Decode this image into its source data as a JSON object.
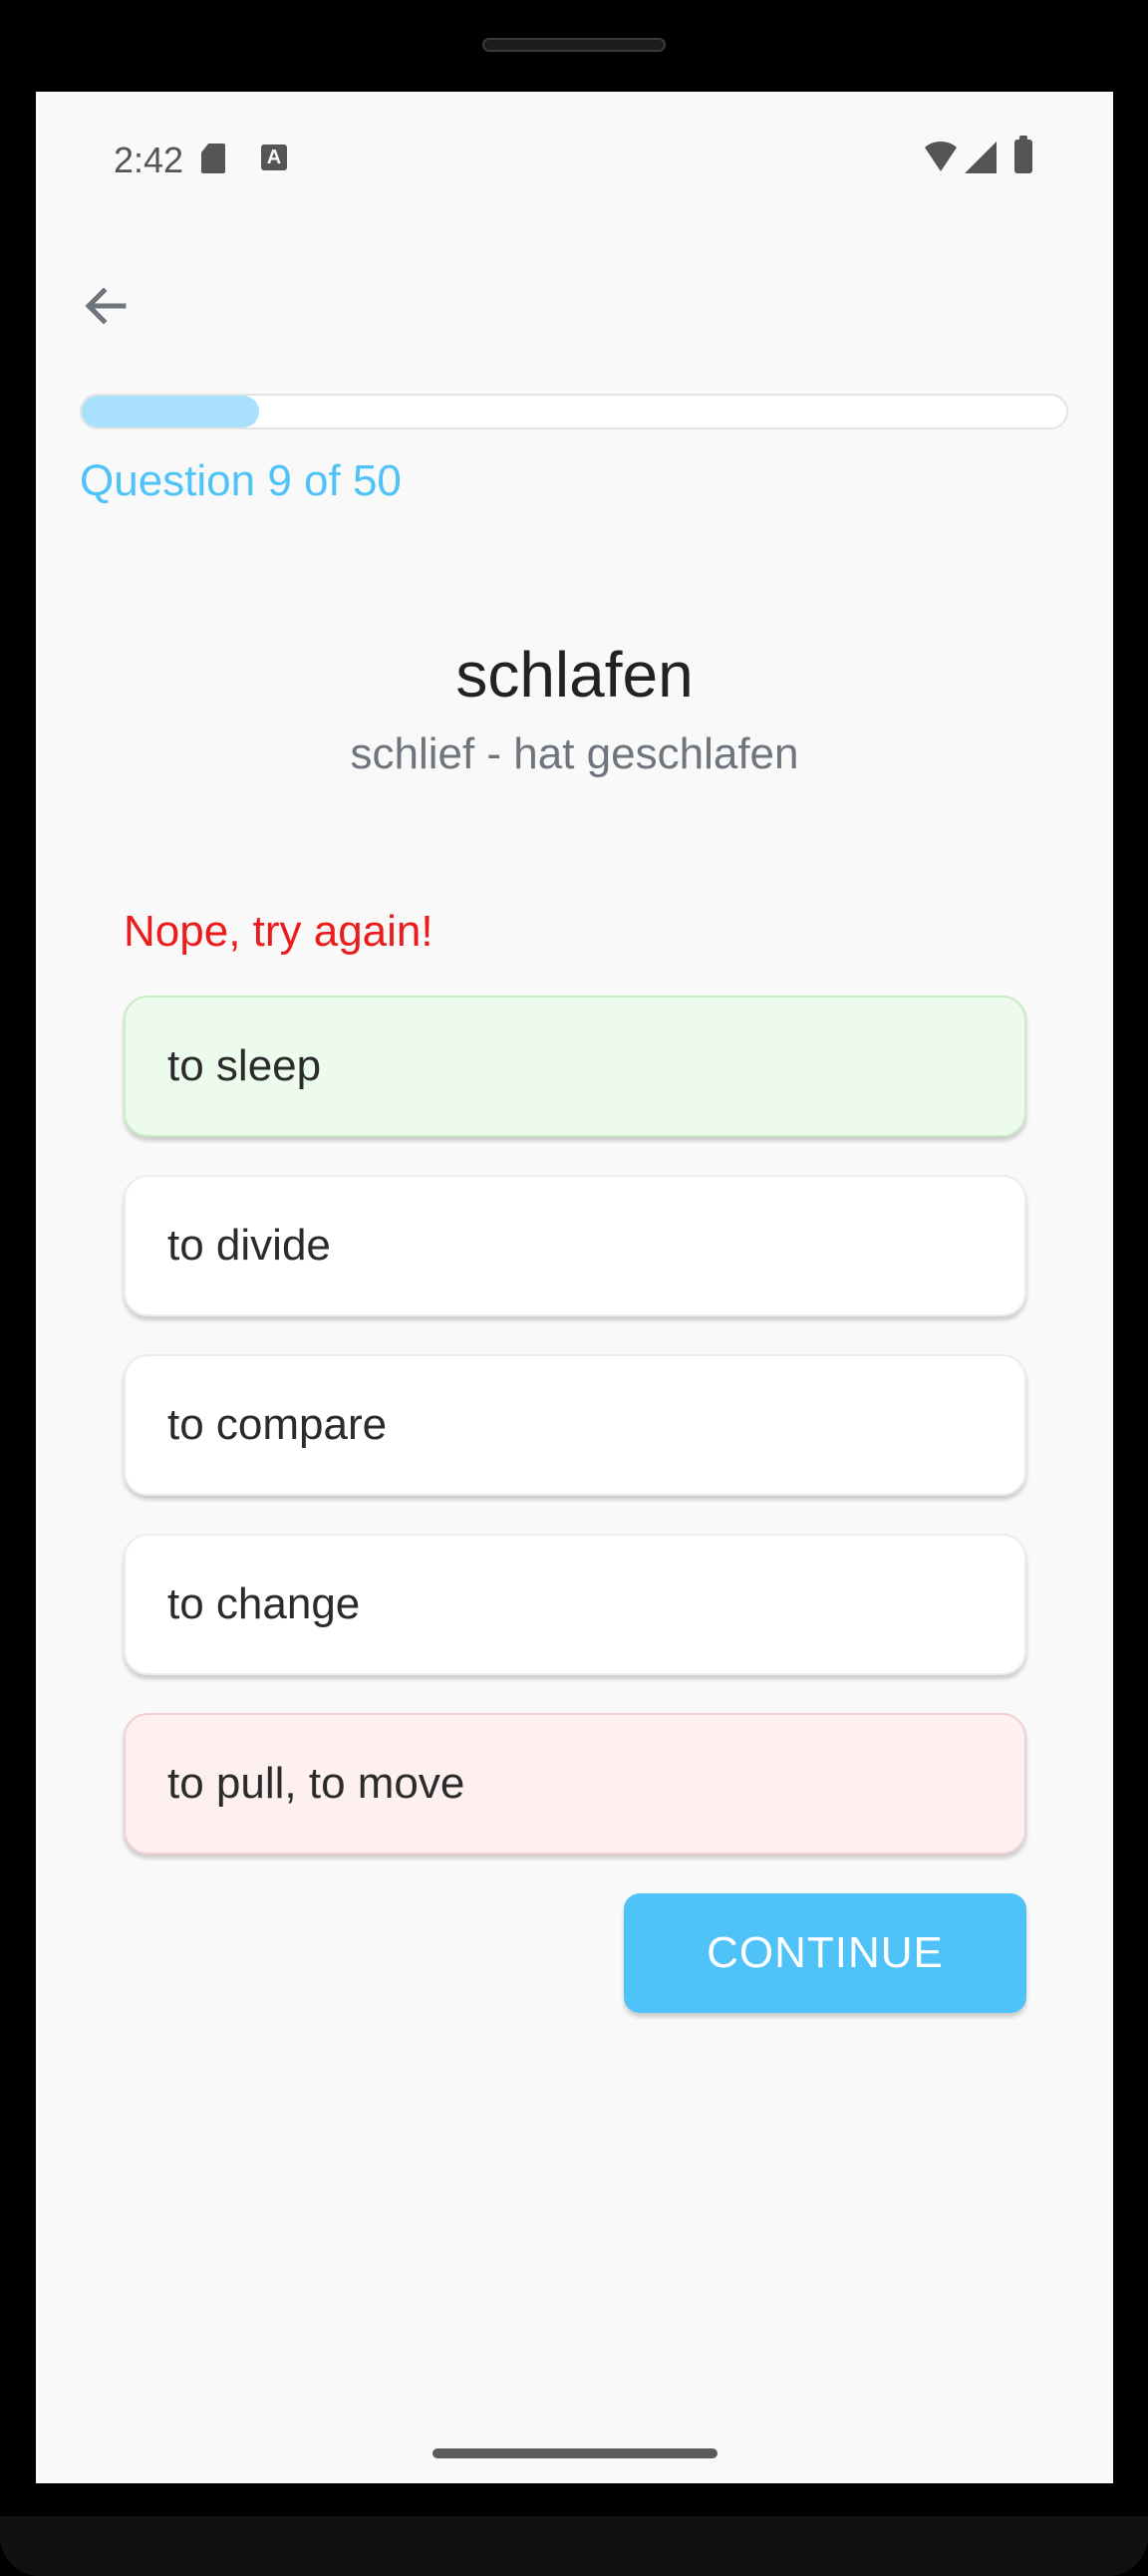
{
  "status_bar": {
    "time": "2:42",
    "icons": [
      "sd-card-icon",
      "text-a-icon",
      "wifi-icon",
      "cell-signal-icon",
      "battery-icon"
    ]
  },
  "nav": {
    "back_icon": "arrow-left-icon"
  },
  "progress": {
    "current": 9,
    "total": 50,
    "fraction": 0.18,
    "label": "Question 9 of 50"
  },
  "question": {
    "word": "schlafen",
    "forms": "schlief - hat geschlafen"
  },
  "feedback": "Nope, try again!",
  "options": [
    {
      "label": "to sleep",
      "state": "correct"
    },
    {
      "label": "to divide",
      "state": "neutral"
    },
    {
      "label": "to compare",
      "state": "neutral"
    },
    {
      "label": "to change",
      "state": "neutral"
    },
    {
      "label": "to pull, to move",
      "state": "wrong"
    }
  ],
  "continue_label": "CONTINUE",
  "colors": {
    "accent": "#4fc3f7",
    "progress_fill": "#a9e0fb",
    "error": "#ec1c1c",
    "correct_bg": "#edfbec",
    "wrong_bg": "#fef0f0"
  }
}
